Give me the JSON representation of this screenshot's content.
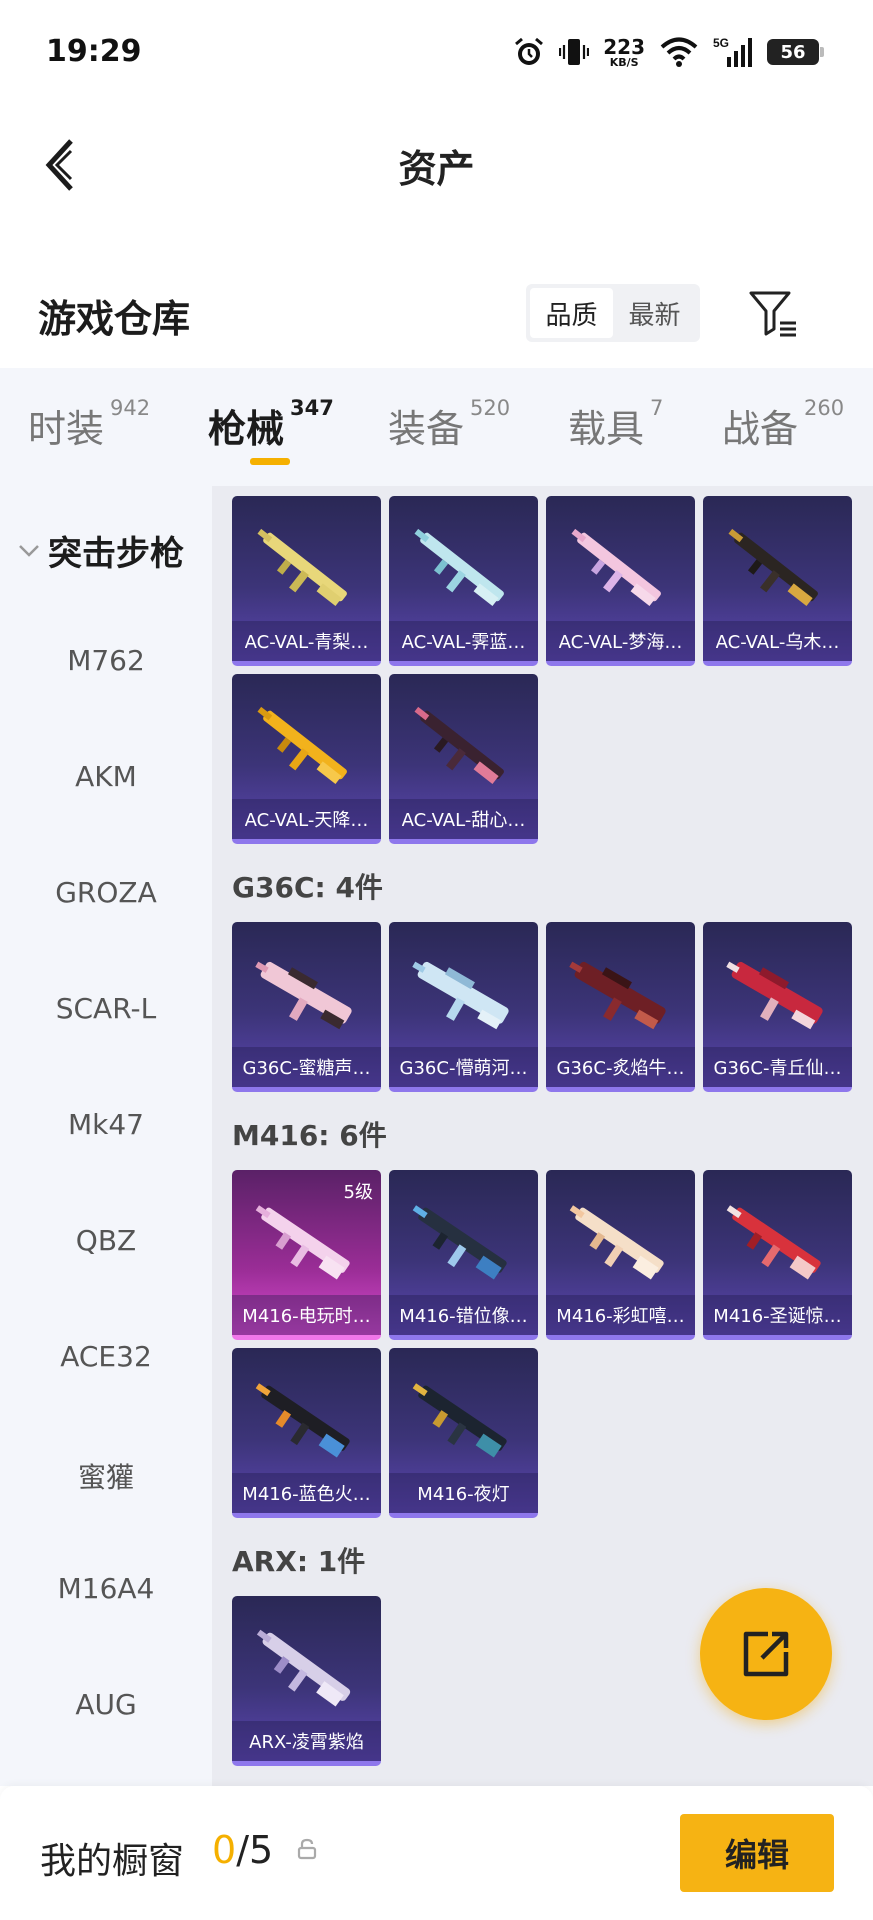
{
  "status_bar": {
    "time": "19:29",
    "net_speed": "223",
    "net_unit": "KB/S",
    "signal": "5G",
    "battery": "56"
  },
  "header": {
    "title": "资产"
  },
  "warehouse": {
    "title": "游戏仓库",
    "sort_options": [
      "品质",
      "最新"
    ],
    "active_sort": "品质"
  },
  "tabs": [
    {
      "label": "时装",
      "count": "942"
    },
    {
      "label": "枪械",
      "count": "347"
    },
    {
      "label": "装备",
      "count": "520"
    },
    {
      "label": "载具",
      "count": "7"
    },
    {
      "label": "战备",
      "count": "260"
    }
  ],
  "active_tab": "枪械",
  "sidebar": {
    "group": "突击步枪",
    "items": [
      "M762",
      "AKM",
      "GROZA",
      "SCAR-L",
      "Mk47",
      "QBZ",
      "ACE32",
      "蜜獾",
      "M16A4",
      "AUG"
    ]
  },
  "groups": [
    {
      "title": "",
      "items": [
        "AC-VAL-青梨…",
        "AC-VAL-霁蓝…",
        "AC-VAL-梦海…",
        "AC-VAL-乌木…",
        "AC-VAL-天降…",
        "AC-VAL-甜心…"
      ]
    },
    {
      "title": "G36C: 4件",
      "items": [
        "G36C-蜜糖声…",
        "G36C-懵萌河…",
        "G36C-炙焰牛…",
        "G36C-青丘仙…"
      ]
    },
    {
      "title": "M416: 6件",
      "items": [
        "M416-电玩时…",
        "M416-错位像…",
        "M416-彩虹嘻…",
        "M416-圣诞惊…",
        "M416-蓝色火…",
        "M416-夜灯"
      ],
      "first_level": "5级"
    },
    {
      "title": "ARX: 1件",
      "items": [
        "ARX-凌霄紫焰"
      ]
    }
  ],
  "bottom_bar": {
    "title": "我的橱窗",
    "current": "0",
    "separator": "/",
    "total": "5",
    "edit_label": "编辑"
  },
  "colors": {
    "accent": "#f6b313",
    "card_purple": "#3c3478",
    "card_pink": "#9a2d96"
  }
}
